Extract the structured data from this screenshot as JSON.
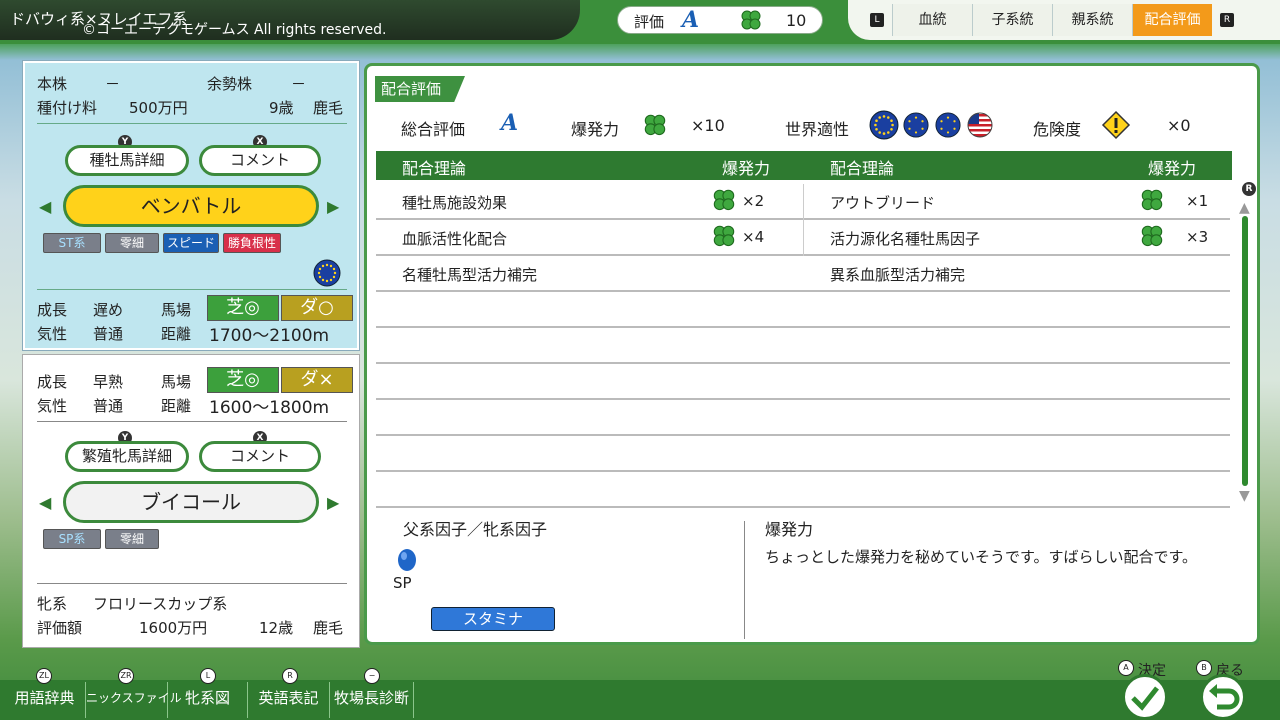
{
  "header": {
    "title": "ドバウィ系×ヌレイエフ系",
    "copyright": "©コーエーテクモゲームス All rights reserved.",
    "rating_label": "評価",
    "rating_grade": "A",
    "rating_count": "10",
    "tabs": [
      {
        "label": "血統",
        "active": false
      },
      {
        "label": "子系統",
        "active": false
      },
      {
        "label": "親系統",
        "active": false
      },
      {
        "label": "配合評価",
        "active": true
      }
    ],
    "left_key": "L",
    "right_key": "R"
  },
  "sire": {
    "stock_label": "本株",
    "stock_value": "－",
    "surplus_label": "余勢株",
    "surplus_value": "－",
    "fee_label": "種付け料",
    "fee_value": "500万円",
    "age": "9歳",
    "coat": "鹿毛",
    "detail_button": "種牡馬詳細",
    "detail_key": "Y",
    "comment_button": "コメント",
    "comment_key": "X",
    "name": "ベンバトル",
    "tags": [
      "ST系",
      "零細",
      "スピード",
      "勝負根性"
    ],
    "growth_label": "成長",
    "growth_value": "遅め",
    "surface_label": "馬場",
    "turf": "芝◎",
    "dirt": "ダ○",
    "temper_label": "気性",
    "temper_value": "普通",
    "distance_label": "距離",
    "distance_value": "1700～2100m"
  },
  "mare": {
    "growth_label": "成長",
    "growth_value": "早熟",
    "surface_label": "馬場",
    "turf": "芝◎",
    "dirt": "ダ×",
    "temper_label": "気性",
    "temper_value": "普通",
    "distance_label": "距離",
    "distance_value": "1600～1800m",
    "detail_button": "繁殖牝馬詳細",
    "detail_key": "Y",
    "comment_button": "コメント",
    "comment_key": "X",
    "name": "ブイコール",
    "tags": [
      "SP系",
      "零細"
    ],
    "line_label": "牝系",
    "line_value": "フロリースカップ系",
    "value_label": "評価額",
    "value_value": "1600万円",
    "age": "12歳",
    "coat": "鹿毛"
  },
  "evaluation": {
    "title": "配合評価",
    "overall_label": "総合評価",
    "overall_grade": "A",
    "power_label": "爆発力",
    "power_value": "×10",
    "world_label": "世界適性",
    "risk_label": "危険度",
    "risk_value": "×0",
    "col_theory": "配合理論",
    "col_power": "爆発力",
    "rows": [
      {
        "left": "種牡馬施設効果",
        "left_power": "×2",
        "right": "アウトブリード",
        "right_power": "×1"
      },
      {
        "left": "血脈活性化配合",
        "left_power": "×4",
        "right": "活力源化名種牡馬因子",
        "right_power": "×3"
      },
      {
        "left": "名種牡馬型活力補完",
        "left_power": "",
        "right": "異系血脈型活力補完",
        "right_power": ""
      }
    ],
    "factor_title": "父系因子／牝系因子",
    "factor_sp": "SP",
    "factor_badge": "スタミナ",
    "desc_title": "爆発力",
    "desc_text": "ちょっとした爆発力を秘めていそうです。すばらしい配合です。"
  },
  "bottom_menu": [
    {
      "label": "用語辞典",
      "key": "ZL"
    },
    {
      "label": "ニックスファイル",
      "key": "ZR"
    },
    {
      "label": "牝系図",
      "key": "L"
    },
    {
      "label": "英語表記",
      "key": "R"
    },
    {
      "label": "牧場長診断",
      "key": "−"
    }
  ],
  "controls": {
    "confirm_key": "A",
    "confirm_label": "決定",
    "back_key": "B",
    "back_label": "戻る"
  },
  "colors": {
    "accent": "#f39a1a",
    "panel_green": "#2e7a30",
    "sire_bg": "#bfe6ef",
    "name_yellow": "#ffd21a"
  }
}
